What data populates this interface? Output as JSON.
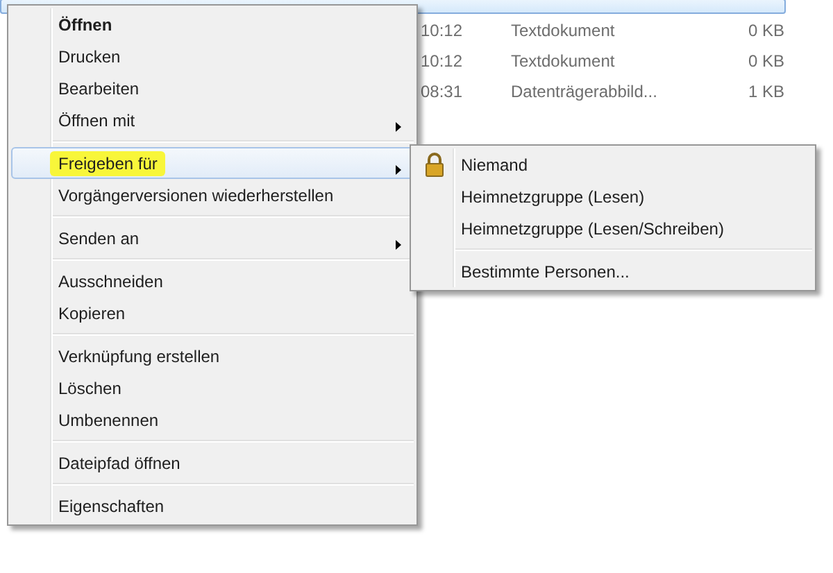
{
  "file_list": {
    "rows": [
      {
        "kind": "cut",
        "selected": true
      },
      {
        "kind": "file",
        "modified": "10:12",
        "type": "Textdokument",
        "size": "0 KB",
        "selected": false
      },
      {
        "kind": "file",
        "modified": "10:12",
        "type": "Textdokument",
        "size": "0 KB",
        "selected": false
      },
      {
        "kind": "file",
        "modified": "08:31",
        "type": "Datenträgerabbild...",
        "size": "1 KB",
        "selected": false
      }
    ]
  },
  "context_menu": {
    "groups": [
      [
        {
          "label": "Öffnen",
          "default": true,
          "submenu": false,
          "selected": false
        },
        {
          "label": "Drucken",
          "default": false,
          "submenu": false,
          "selected": false
        },
        {
          "label": "Bearbeiten",
          "default": false,
          "submenu": false,
          "selected": false
        },
        {
          "label": "Öffnen mit",
          "default": false,
          "submenu": true,
          "selected": false
        }
      ],
      [
        {
          "label": "Freigeben für",
          "default": false,
          "submenu": true,
          "selected": true
        },
        {
          "label": "Vorgängerversionen wiederherstellen",
          "default": false,
          "submenu": false,
          "selected": false
        }
      ],
      [
        {
          "label": "Senden an",
          "default": false,
          "submenu": true,
          "selected": false
        }
      ],
      [
        {
          "label": "Ausschneiden",
          "default": false,
          "submenu": false,
          "selected": false
        },
        {
          "label": "Kopieren",
          "default": false,
          "submenu": false,
          "selected": false
        }
      ],
      [
        {
          "label": "Verknüpfung erstellen",
          "default": false,
          "submenu": false,
          "selected": false
        },
        {
          "label": "Löschen",
          "default": false,
          "submenu": false,
          "selected": false
        },
        {
          "label": "Umbenennen",
          "default": false,
          "submenu": false,
          "selected": false
        }
      ],
      [
        {
          "label": "Dateipfad öffnen",
          "default": false,
          "submenu": false,
          "selected": false
        }
      ],
      [
        {
          "label": "Eigenschaften",
          "default": false,
          "submenu": false,
          "selected": false
        }
      ]
    ]
  },
  "submenu": {
    "groups": [
      [
        {
          "label": "Niemand",
          "kind": "lock",
          "selected": false
        },
        {
          "label": "Heimnetzgruppe (Lesen)",
          "kind": "plain",
          "selected": false
        },
        {
          "label": "Heimnetzgruppe (Lesen/Schreiben)",
          "kind": "plain",
          "selected": false
        }
      ],
      [
        {
          "label": "Bestimmte Personen...",
          "kind": "plain",
          "selected": false
        }
      ]
    ]
  }
}
